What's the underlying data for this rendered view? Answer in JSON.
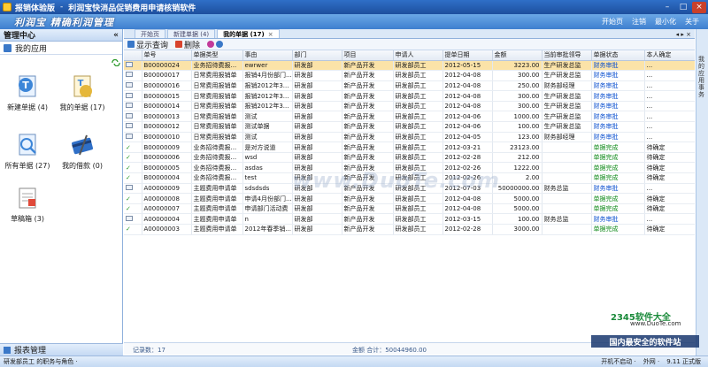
{
  "window": {
    "title": "报销体验版",
    "subtitle": "利润宝快消品促销费用申请核销软件",
    "min_label": "–",
    "max_label": "□",
    "close_label": "×"
  },
  "banner": {
    "logo_text": "利润宝 精确利润管理",
    "menu": [
      "开始页",
      "注销",
      "最小化",
      "关于"
    ]
  },
  "left_panel": {
    "title": "管理中心",
    "collapse_label": "«",
    "section": "我的应用",
    "tiles": [
      {
        "label": "新建单据 (4)",
        "icon": "new-document-icon"
      },
      {
        "label": "我的单据 (17)",
        "icon": "my-documents-icon"
      },
      {
        "label": "所有单据 (27)",
        "icon": "all-documents-icon"
      },
      {
        "label": "我的借款 (0)",
        "icon": "loan-card-icon"
      },
      {
        "label": "草稿箱 (3)",
        "icon": "drafts-icon"
      }
    ],
    "footer": "报表管理"
  },
  "tabs": {
    "items": [
      {
        "label": "开始页",
        "active": false
      },
      {
        "label": "新建单据 (4)",
        "active": false
      },
      {
        "label": "我的单据 (17)",
        "active": true
      }
    ],
    "controls": "◂ ▸ ×"
  },
  "toolbar": {
    "query_label": "显示查询",
    "delete_label": "删除"
  },
  "table": {
    "columns": [
      "",
      "单号",
      "单据类型",
      "事由",
      "部门",
      "项目",
      "申请人",
      "提单日期",
      "金额",
      "当前审批领导",
      "单据状态",
      "本人确定"
    ],
    "rows": [
      {
        "icon": "doc",
        "no": "B00000024",
        "type": "业务招待费报...",
        "reason": "ewrwer",
        "dept": "研发部",
        "project": "新产品开发",
        "applicant": "研发部员工",
        "date": "2012-05-15",
        "amount": "3223.00",
        "approver": "生产研发总监",
        "status": "财务审批",
        "status_color": "blue",
        "confirm": "...",
        "selected": true
      },
      {
        "icon": "doc",
        "no": "B00000017",
        "type": "日常费用报销单",
        "reason": "报销4月份部门...",
        "dept": "研发部",
        "project": "新产品开发",
        "applicant": "研发部员工",
        "date": "2012-04-08",
        "amount": "300.00",
        "approver": "生产研发总监",
        "status": "财务审批",
        "status_color": "blue",
        "confirm": "..."
      },
      {
        "icon": "doc",
        "no": "B00000016",
        "type": "日常费用报销单",
        "reason": "报销2012年3...",
        "dept": "研发部",
        "project": "新产品开发",
        "applicant": "研发部员工",
        "date": "2012-04-08",
        "amount": "250.00",
        "approver": "财务部经理",
        "status": "财务审批",
        "status_color": "blue",
        "confirm": "..."
      },
      {
        "icon": "doc",
        "no": "B00000015",
        "type": "日常费用报销单",
        "reason": "报销2012年3...",
        "dept": "研发部",
        "project": "新产品开发",
        "applicant": "研发部员工",
        "date": "2012-04-08",
        "amount": "300.00",
        "approver": "生产研发总监",
        "status": "财务审批",
        "status_color": "blue",
        "confirm": "..."
      },
      {
        "icon": "doc",
        "no": "B00000014",
        "type": "日常费用报销单",
        "reason": "报销2012年3...",
        "dept": "研发部",
        "project": "新产品开发",
        "applicant": "研发部员工",
        "date": "2012-04-08",
        "amount": "300.00",
        "approver": "生产研发总监",
        "status": "财务审批",
        "status_color": "blue",
        "confirm": "..."
      },
      {
        "icon": "doc",
        "no": "B00000013",
        "type": "日常费用报销单",
        "reason": "测试",
        "dept": "研发部",
        "project": "新产品开发",
        "applicant": "研发部员工",
        "date": "2012-04-06",
        "amount": "1000.00",
        "approver": "生产研发总监",
        "status": "财务审批",
        "status_color": "blue",
        "confirm": "..."
      },
      {
        "icon": "doc",
        "no": "B00000012",
        "type": "日常费用报销单",
        "reason": "测试单据",
        "dept": "研发部",
        "project": "新产品开发",
        "applicant": "研发部员工",
        "date": "2012-04-06",
        "amount": "100.00",
        "approver": "生产研发总监",
        "status": "财务审批",
        "status_color": "blue",
        "confirm": "..."
      },
      {
        "icon": "doc",
        "no": "B00000010",
        "type": "日常费用报销单",
        "reason": "测试",
        "dept": "研发部",
        "project": "新产品开发",
        "applicant": "研发部员工",
        "date": "2012-04-05",
        "amount": "123.00",
        "approver": "财务部经理",
        "status": "财务审批",
        "status_color": "blue",
        "confirm": "..."
      },
      {
        "icon": "check",
        "no": "B00000009",
        "type": "业务招待费报...",
        "reason": "是对方说道",
        "dept": "研发部",
        "project": "新产品开发",
        "applicant": "研发部员工",
        "date": "2012-03-21",
        "amount": "23123.00",
        "approver": "",
        "status": "单据完成",
        "status_color": "green",
        "confirm": "待确定"
      },
      {
        "icon": "check",
        "no": "B00000006",
        "type": "业务招待费报...",
        "reason": "wsd",
        "dept": "研发部",
        "project": "新产品开发",
        "applicant": "研发部员工",
        "date": "2012-02-28",
        "amount": "212.00",
        "approver": "",
        "status": "单据完成",
        "status_color": "green",
        "confirm": "待确定"
      },
      {
        "icon": "check",
        "no": "B00000005",
        "type": "业务招待费报...",
        "reason": "asdas",
        "dept": "研发部",
        "project": "新产品开发",
        "applicant": "研发部员工",
        "date": "2012-02-26",
        "amount": "1222.00",
        "approver": "",
        "status": "单据完成",
        "status_color": "green",
        "confirm": "待确定"
      },
      {
        "icon": "check",
        "no": "B00000004",
        "type": "业务招待费报...",
        "reason": "test",
        "dept": "研发部",
        "project": "新产品开发",
        "applicant": "研发部员工",
        "date": "2012-02-26",
        "amount": "2.00",
        "approver": "",
        "status": "单据完成",
        "status_color": "green",
        "confirm": "待确定"
      },
      {
        "icon": "doc",
        "no": "A00000009",
        "type": "主题费用申请单",
        "reason": "sdsdsds",
        "dept": "研发部",
        "project": "新产品开发",
        "applicant": "研发部员工",
        "date": "2012-07-03",
        "amount": "50000000.00",
        "approver": "财务总监",
        "status": "财务审批",
        "status_color": "blue",
        "confirm": "..."
      },
      {
        "icon": "check",
        "no": "A00000008",
        "type": "主题费用申请单",
        "reason": "申请4月份部门...",
        "dept": "研发部",
        "project": "新产品开发",
        "applicant": "研发部员工",
        "date": "2012-04-08",
        "amount": "5000.00",
        "approver": "",
        "status": "单据完成",
        "status_color": "green",
        "confirm": "待确定"
      },
      {
        "icon": "check",
        "no": "A00000007",
        "type": "主题费用申请单",
        "reason": "申请部门活动费",
        "dept": "研发部",
        "project": "新产品开发",
        "applicant": "研发部员工",
        "date": "2012-04-08",
        "amount": "5000.00",
        "approver": "",
        "status": "单据完成",
        "status_color": "green",
        "confirm": "待确定"
      },
      {
        "icon": "doc",
        "no": "A00000004",
        "type": "主题费用申请单",
        "reason": "n",
        "dept": "研发部",
        "project": "新产品开发",
        "applicant": "研发部员工",
        "date": "2012-03-15",
        "amount": "100.00",
        "approver": "财务总监",
        "status": "财务审批",
        "status_color": "blue",
        "confirm": "..."
      },
      {
        "icon": "check",
        "no": "A00000003",
        "type": "主题费用申请单",
        "reason": "2012年春季销...",
        "dept": "研发部",
        "project": "新产品开发",
        "applicant": "研发部员工",
        "date": "2012-02-28",
        "amount": "3000.00",
        "approver": "",
        "status": "单据完成",
        "status_color": "green",
        "confirm": "待确定"
      }
    ]
  },
  "summary": {
    "count": "记录数：17",
    "amount": "金额  合计：50044960.00"
  },
  "right_strip": {
    "label": "我的应用事务"
  },
  "statusbar": {
    "user": "研发部员工 的职务与角色 ·",
    "right": [
      "开机不启动 ·",
      "外网 ·",
      "9.11 正式版"
    ]
  },
  "watermarks": {
    "center": "www.DuoTe.com",
    "logo": "2345软件大全",
    "site": "www.DuoTe.com",
    "bar": "国内最安全的软件站"
  }
}
